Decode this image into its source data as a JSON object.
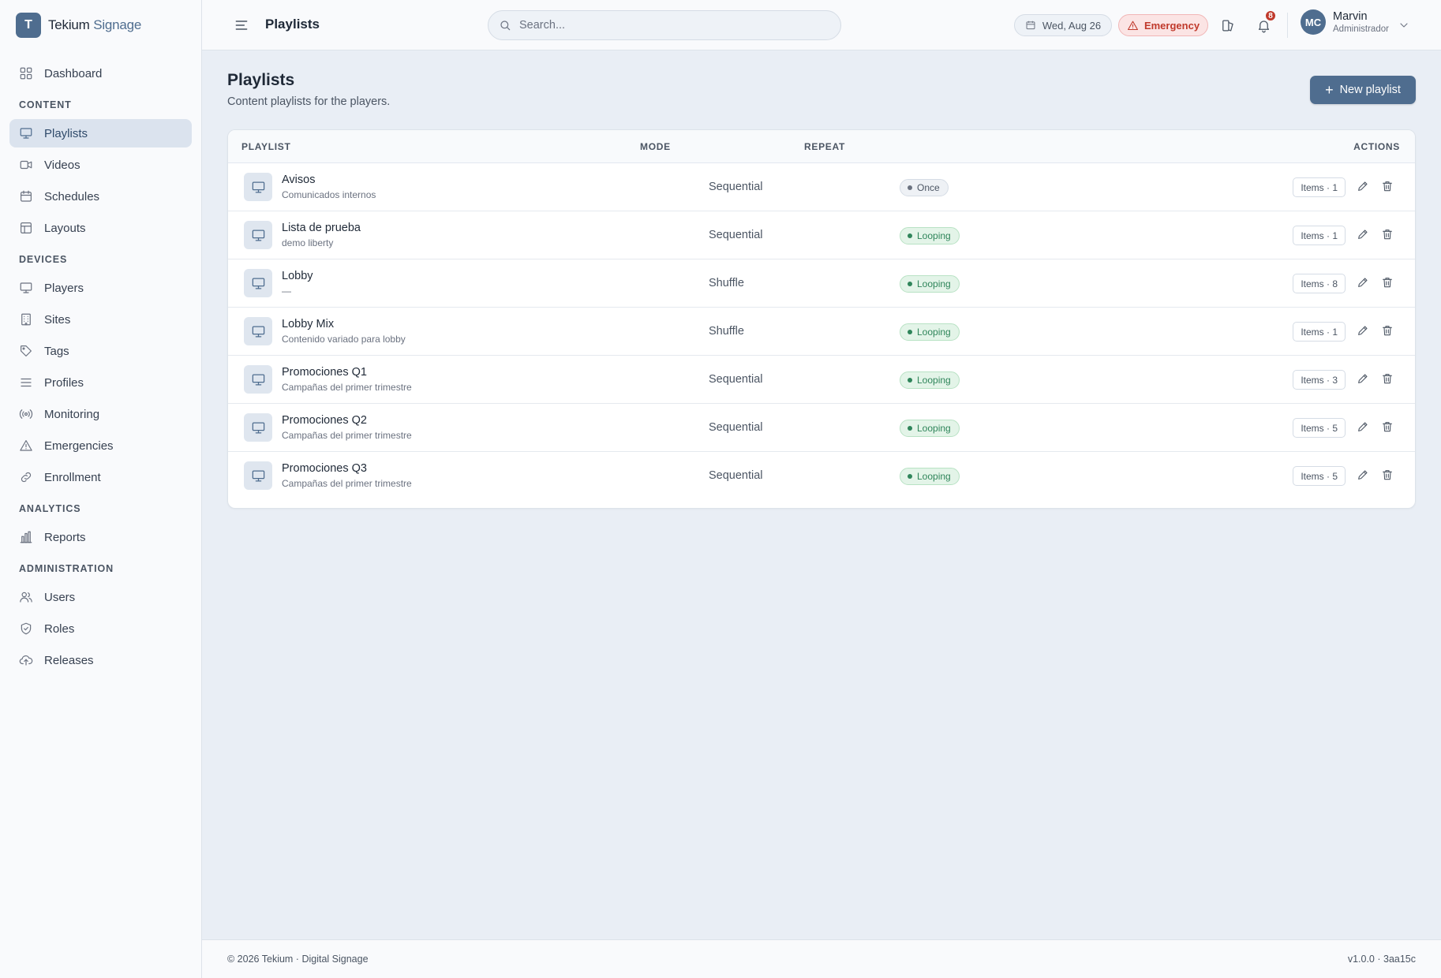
{
  "brand": {
    "logo_letter": "T",
    "name_main": "Tekium",
    "name_accent": "Signage"
  },
  "sidebar": {
    "dashboard": {
      "label": "Dashboard",
      "icon": "grid-icon"
    },
    "sections": [
      {
        "title": "CONTENT",
        "items": [
          {
            "label": "Playlists",
            "icon": "monitor-icon",
            "active": true
          },
          {
            "label": "Videos",
            "icon": "video-icon"
          },
          {
            "label": "Schedules",
            "icon": "calendar-icon"
          },
          {
            "label": "Layouts",
            "icon": "layout-icon"
          }
        ]
      },
      {
        "title": "DEVICES",
        "items": [
          {
            "label": "Players",
            "icon": "monitor-icon"
          },
          {
            "label": "Sites",
            "icon": "building-icon"
          },
          {
            "label": "Tags",
            "icon": "tag-icon"
          },
          {
            "label": "Profiles",
            "icon": "list-icon"
          },
          {
            "label": "Monitoring",
            "icon": "broadcast-icon"
          },
          {
            "label": "Emergencies",
            "icon": "alert-icon"
          },
          {
            "label": "Enrollment",
            "icon": "link-icon"
          }
        ]
      },
      {
        "title": "ANALYTICS",
        "items": [
          {
            "label": "Reports",
            "icon": "bar-chart-icon"
          }
        ]
      },
      {
        "title": "ADMINISTRATION",
        "items": [
          {
            "label": "Users",
            "icon": "users-icon"
          },
          {
            "label": "Roles",
            "icon": "shield-icon"
          },
          {
            "label": "Releases",
            "icon": "cloud-upload-icon"
          }
        ]
      }
    ]
  },
  "topbar": {
    "title": "Playlists",
    "search_placeholder": "Search...",
    "date": "Wed, Aug 26",
    "emergency_label": "Emergency",
    "notification_count": "8",
    "user": {
      "initials": "MC",
      "name": "Marvin",
      "role": "Administrador"
    }
  },
  "page": {
    "title": "Playlists",
    "subtitle": "Content playlists for the players.",
    "new_button": "New playlist"
  },
  "table": {
    "headers": {
      "playlist": "PLAYLIST",
      "mode": "MODE",
      "repeat": "REPEAT",
      "actions": "ACTIONS"
    },
    "rows": [
      {
        "name": "Avisos",
        "description": "Comunicados internos",
        "mode": "Sequential",
        "repeat": "Once",
        "items": "Items · 1"
      },
      {
        "name": "Lista de prueba",
        "description": "demo liberty",
        "mode": "Sequential",
        "repeat": "Looping",
        "items": "Items · 1"
      },
      {
        "name": "Lobby",
        "description": "—",
        "mode": "Shuffle",
        "repeat": "Looping",
        "items": "Items · 8"
      },
      {
        "name": "Lobby Mix",
        "description": "Contenido variado para lobby",
        "mode": "Shuffle",
        "repeat": "Looping",
        "items": "Items · 1"
      },
      {
        "name": "Promociones Q1",
        "description": "Campañas del primer trimestre",
        "mode": "Sequential",
        "repeat": "Looping",
        "items": "Items · 3"
      },
      {
        "name": "Promociones Q2",
        "description": "Campañas del primer trimestre",
        "mode": "Sequential",
        "repeat": "Looping",
        "items": "Items · 5"
      },
      {
        "name": "Promociones Q3",
        "description": "Campañas del primer trimestre",
        "mode": "Sequential",
        "repeat": "Looping",
        "items": "Items · 5"
      }
    ]
  },
  "footer": {
    "left": "© 2026 Tekium · Digital Signage",
    "right": "v1.0.0 · 3aa15c"
  },
  "colors": {
    "accent": "#4f6d8f",
    "looping": "#2f855a",
    "emergency": "#c0392b"
  }
}
